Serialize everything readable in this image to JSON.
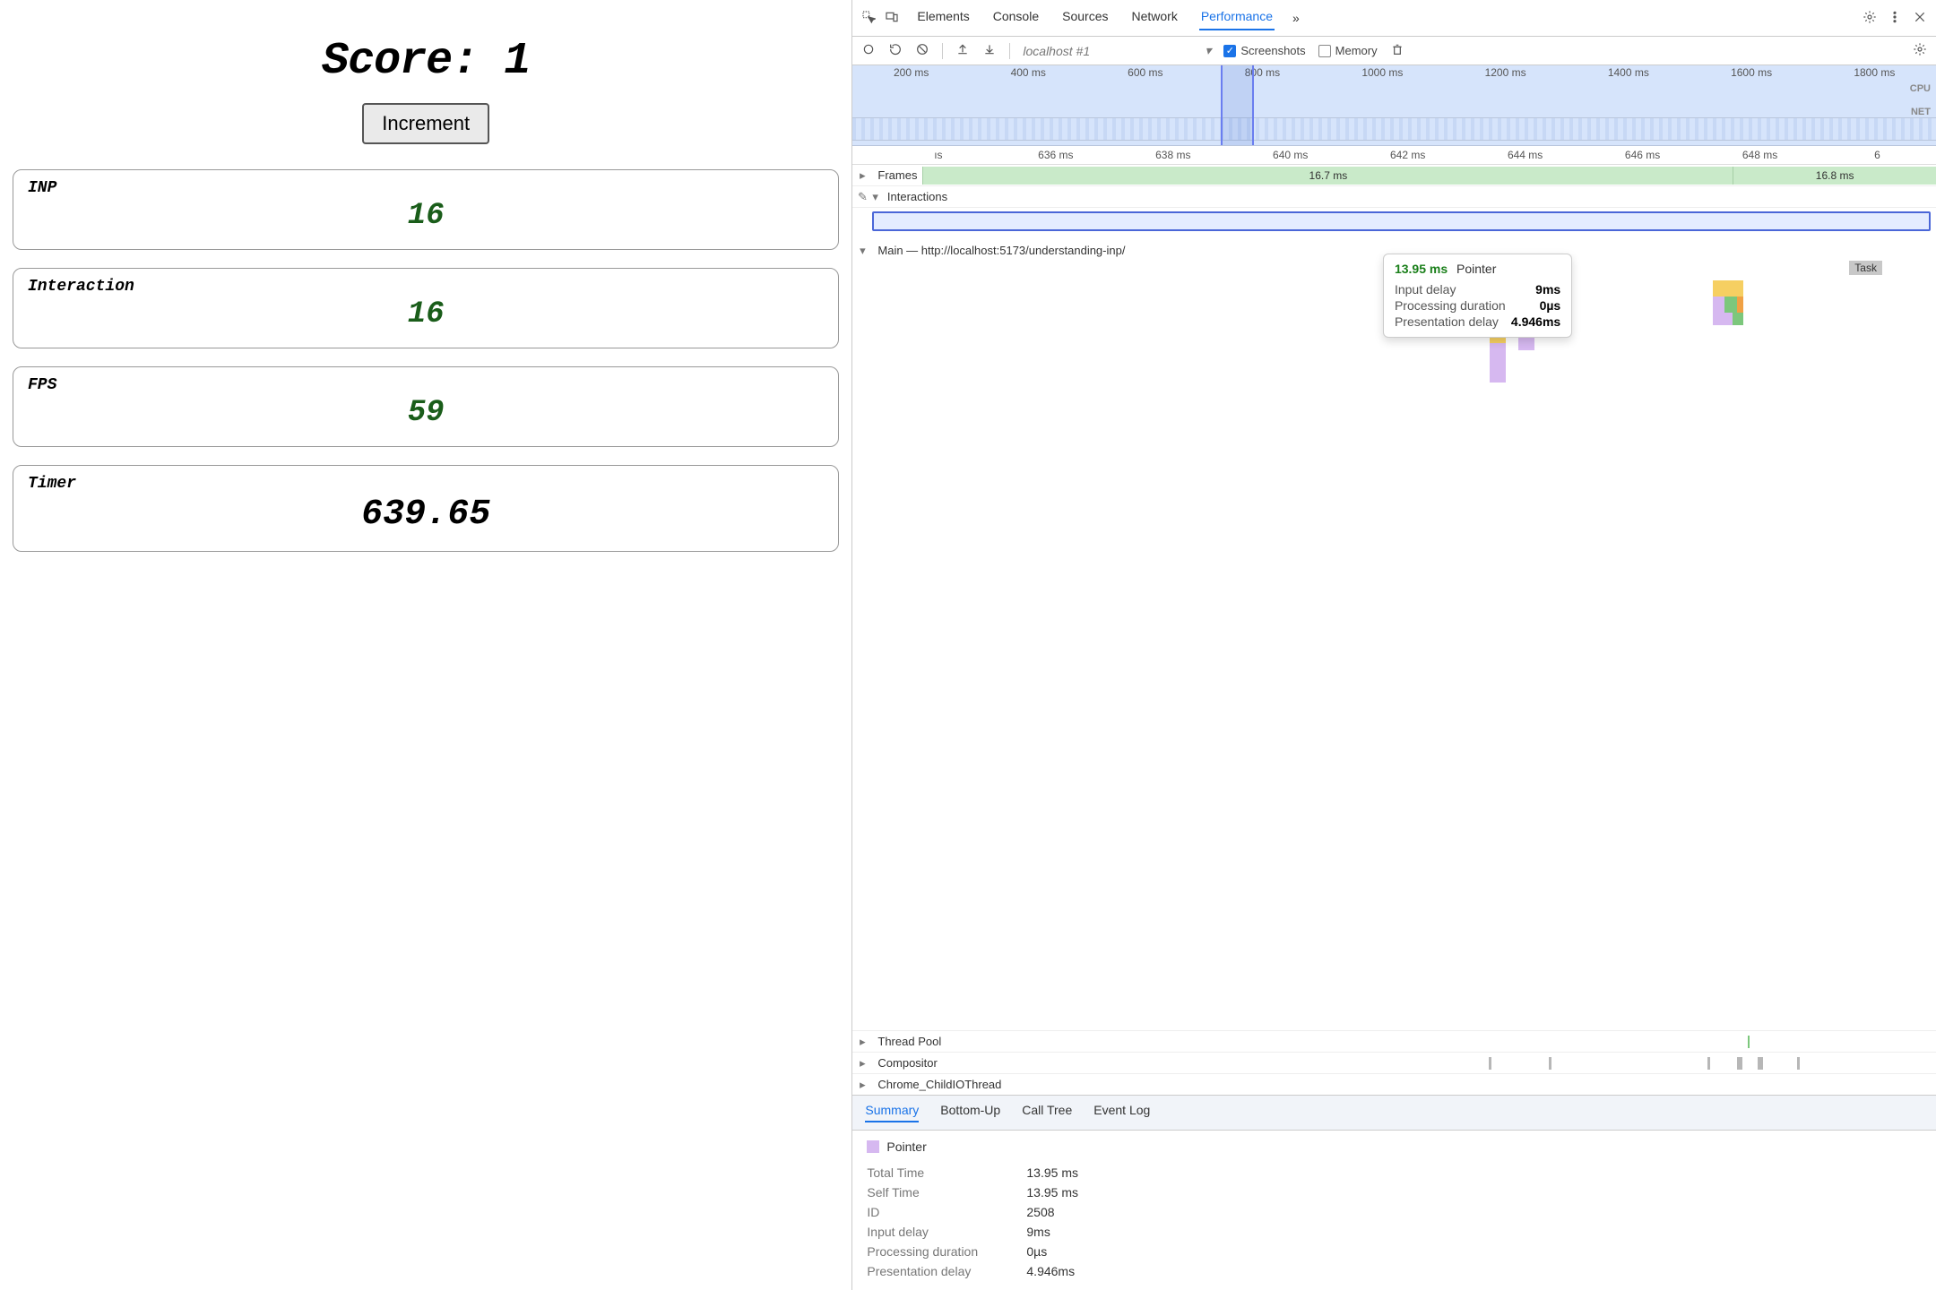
{
  "app": {
    "score_label": "Score: ",
    "score_value": "1",
    "increment_label": "Increment",
    "cards": [
      {
        "title": "INP",
        "value": "16",
        "big": false
      },
      {
        "title": "Interaction",
        "value": "16",
        "big": false
      },
      {
        "title": "FPS",
        "value": "59",
        "big": false
      },
      {
        "title": "Timer",
        "value": "639.65",
        "big": true
      }
    ]
  },
  "devtools": {
    "panel_tabs": [
      "Elements",
      "Console",
      "Sources",
      "Network",
      "Performance"
    ],
    "active_panel": "Performance",
    "more_tabs": "»",
    "toolbar": {
      "target": "localhost #1",
      "screenshots_label": "Screenshots",
      "screenshots_checked": true,
      "memory_label": "Memory",
      "memory_checked": false
    },
    "overview": {
      "ticks": [
        "200 ms",
        "400 ms",
        "600 ms",
        "800 ms",
        "1000 ms",
        "1200 ms",
        "1400 ms",
        "1600 ms",
        "1800 ms"
      ],
      "cpu_label": "CPU",
      "net_label": "NET",
      "brush_start_pct": 34,
      "brush_end_pct": 37
    },
    "flame": {
      "ruler": [
        "ıs",
        "636 ms",
        "638 ms",
        "640 ms",
        "642 ms",
        "644 ms",
        "646 ms",
        "648 ms",
        "6"
      ],
      "frames_label": "Frames",
      "frame_values": [
        "16.7 ms",
        "16.8 ms"
      ],
      "interactions_label": "Interactions",
      "main_label": "Main — http://localhost:5173/understanding-inp/",
      "task_badge": "Task",
      "thread_pool_label": "Thread Pool",
      "compositor_label": "Compositor",
      "child_io_label": "Chrome_ChildIOThread"
    },
    "tooltip": {
      "time": "13.95 ms",
      "type": "Pointer",
      "rows": [
        {
          "k": "Input delay",
          "v": "9ms"
        },
        {
          "k": "Processing duration",
          "v": "0µs"
        },
        {
          "k": "Presentation delay",
          "v": "4.946ms"
        }
      ]
    },
    "bottom_tabs": [
      "Summary",
      "Bottom-Up",
      "Call Tree",
      "Event Log"
    ],
    "bottom_active": "Summary",
    "summary": {
      "event_name": "Pointer",
      "rows": [
        {
          "k": "Total Time",
          "v": "13.95 ms"
        },
        {
          "k": "Self Time",
          "v": "13.95 ms"
        },
        {
          "k": "ID",
          "v": "2508"
        },
        {
          "k": "Input delay",
          "v": "9ms"
        },
        {
          "k": "Processing duration",
          "v": "0µs"
        },
        {
          "k": "Presentation delay",
          "v": "4.946ms"
        }
      ]
    }
  }
}
